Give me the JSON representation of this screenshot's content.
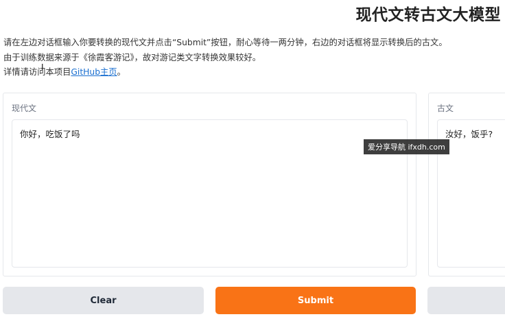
{
  "header": {
    "title": "现代文转古文大模型"
  },
  "description": {
    "line1": "请在左边对话框输入你要转换的现代文并点击“Submit”按钮，耐心等待一两分钟，右边的对话框将显示转换后的古文。",
    "line2": "由于训练数据来源于《徐霞客游记》，故对游记类文字转换效果较好。",
    "line3_prefix": "详情请访问本项目",
    "link_text": "GitHub主页",
    "line3_suffix": "。"
  },
  "input_panel": {
    "label": "现代文",
    "value": "你好，吃饭了吗"
  },
  "output_panel": {
    "label": "古文",
    "value": "汝好，饭乎?"
  },
  "buttons": {
    "clear_label": "Clear",
    "submit_label": "Submit"
  },
  "watermark": {
    "text": "爱分享导航 ifxdh.com"
  },
  "colors": {
    "accent": "#f97316",
    "link": "#1a6fd0",
    "button_gray": "#e5e7eb"
  }
}
